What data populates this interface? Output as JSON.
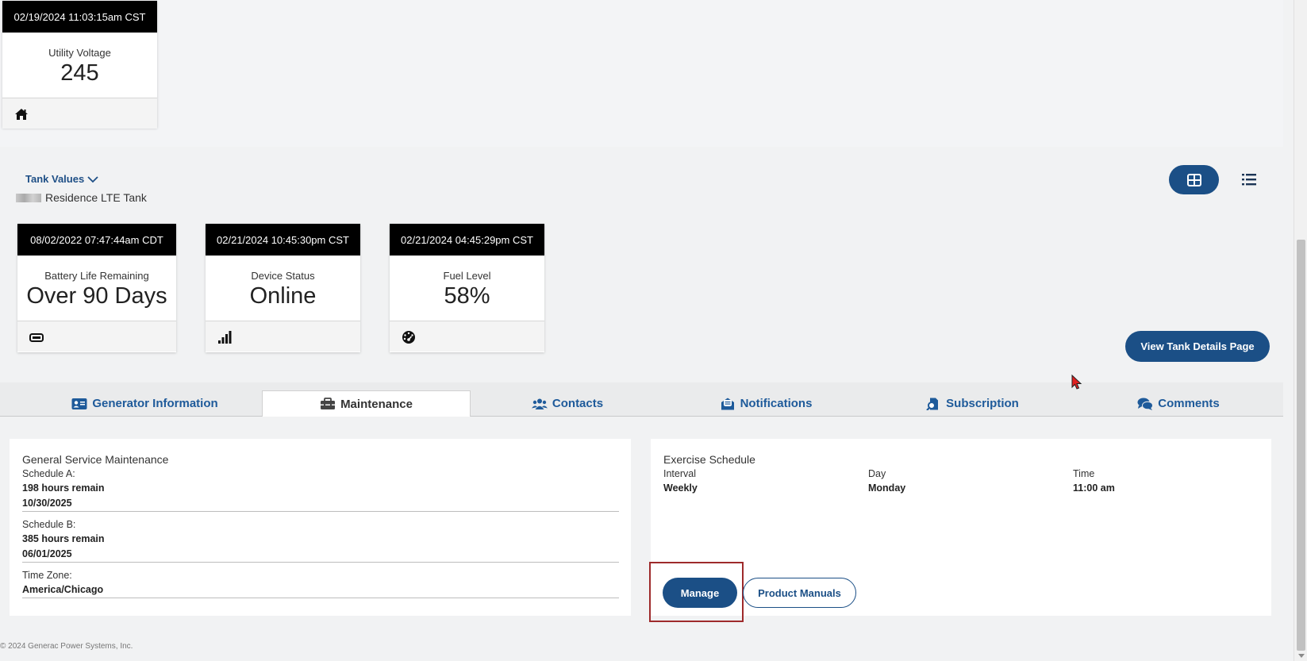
{
  "top_card": {
    "timestamp": "02/19/2024 11:03:15am CST",
    "label": "Utility Voltage",
    "value": "245",
    "icon": "home-icon"
  },
  "tank": {
    "toggle_label": "Tank Values",
    "name": "Residence LTE Tank",
    "view_details_label": "View Tank Details Page",
    "cards": [
      {
        "timestamp": "08/02/2022 07:47:44am CDT",
        "label": "Battery Life Remaining",
        "value": "Over 90 Days",
        "icon": "battery-icon"
      },
      {
        "timestamp": "02/21/2024 10:45:30pm CST",
        "label": "Device Status",
        "value": "Online",
        "icon": "signal-icon"
      },
      {
        "timestamp": "02/21/2024 04:45:29pm CST",
        "label": "Fuel Level",
        "value": "58%",
        "icon": "gauge-icon"
      }
    ]
  },
  "tabs": [
    {
      "label": "Generator Information",
      "icon": "id-card-icon"
    },
    {
      "label": "Maintenance",
      "icon": "toolbox-icon",
      "active": true
    },
    {
      "label": "Contacts",
      "icon": "users-icon"
    },
    {
      "label": "Notifications",
      "icon": "envelope-open-icon"
    },
    {
      "label": "Subscription",
      "icon": "file-search-icon"
    },
    {
      "label": "Comments",
      "icon": "comments-icon"
    }
  ],
  "maintenance": {
    "title": "General Service Maintenance",
    "schedule_a_label": "Schedule A:",
    "schedule_a_hours": "198 hours remain",
    "schedule_a_date": "10/30/2025",
    "schedule_b_label": "Schedule B:",
    "schedule_b_hours": "385 hours remain",
    "schedule_b_date": "06/01/2025",
    "timezone_label": "Time Zone:",
    "timezone_value": "America/Chicago"
  },
  "exercise": {
    "title": "Exercise Schedule",
    "interval_label": "Interval",
    "interval_value": "Weekly",
    "day_label": "Day",
    "day_value": "Monday",
    "time_label": "Time",
    "time_value": "11:00 am",
    "manage_label": "Manage",
    "manuals_label": "Product Manuals"
  },
  "footer": {
    "copyright": "© 2024 Generac Power Systems, Inc."
  },
  "colors": {
    "primary": "#1b4f86",
    "highlight_border": "#9e2a2b",
    "card_header": "#000000"
  }
}
